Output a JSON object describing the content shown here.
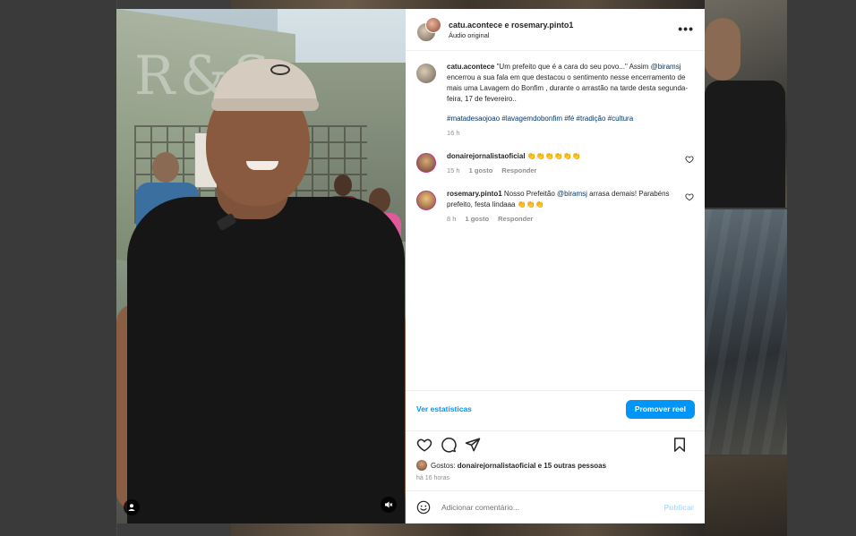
{
  "post": {
    "header": {
      "names": "catu.acontece e rosemary.pinto1",
      "audio": "Áudio original",
      "more_label": "•••"
    },
    "caption": {
      "username": "catu.acontece",
      "text_1": " \"Um prefeito que é a cara do seu povo...\" Assim ",
      "mention": "@biramsj",
      "text_2": " encerrou a sua fala em que destacou o sentimento nesse encerramento de mais uma Lavagem do Bonfim , durante o arrastão na tarde desta segunda-feira, 17 de fevereiro..",
      "hashtags": "#matadesaojoao #lavagemdobonfim #fé #tradição #cultura",
      "time": "16 h"
    },
    "comments": [
      {
        "username": "donairejornalistaoficial",
        "text": " 👏👏👏👏👏👏",
        "time": "15 h",
        "likes": "1 gosto",
        "reply": "Responder"
      },
      {
        "username": "rosemary.pinto1",
        "text_1": " Nosso Prefeitão ",
        "mention": "@biramsj",
        "text_2": " arrasa demais! Parabéns prefeito, festa lindaaa 👏👏👏",
        "time": "8 h",
        "likes": "1 gosto",
        "reply": "Responder"
      }
    ],
    "stats_link": "Ver estatísticas",
    "promote_button": "Promover reel",
    "likes": {
      "prefix": "Gostos: ",
      "users": "donairejornalistaoficial e 15 outras pessoas"
    },
    "time_ago": "há 16 horas",
    "add_comment_placeholder": "Adicionar comentário...",
    "publish_label": "Publicar"
  },
  "colors": {
    "accent": "#0095f6",
    "link": "#00376b",
    "muted": "#8e8e8e"
  },
  "icons": [
    "more-icon",
    "heart-icon",
    "comment-icon",
    "share-icon",
    "save-icon",
    "emoji-icon",
    "user-tag-icon",
    "mute-icon"
  ]
}
